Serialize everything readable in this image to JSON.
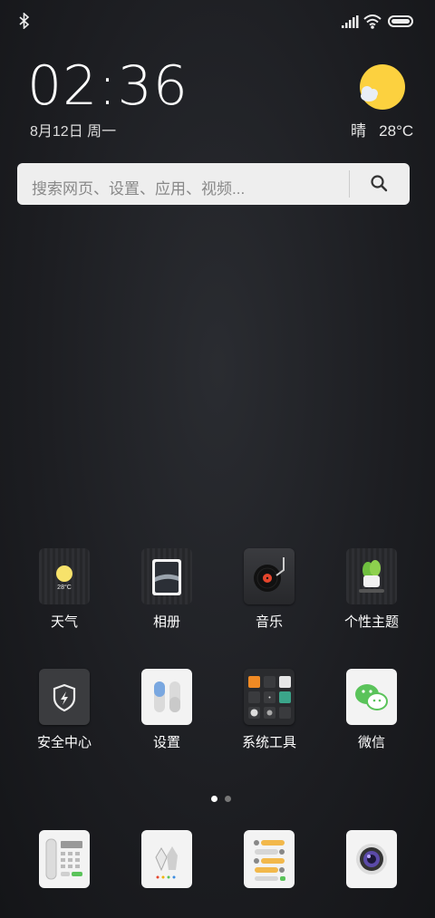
{
  "status_bar": {
    "bluetooth_icon": "bluetooth-icon",
    "signal_icon": "cell-signal-icon",
    "wifi_icon": "wifi-icon",
    "battery_icon": "battery-icon"
  },
  "clock": {
    "time": "02:36",
    "date": "8月12日 周一"
  },
  "weather": {
    "condition": "晴",
    "temperature": "28°C",
    "icon": "partly-sunny-icon"
  },
  "search": {
    "placeholder": "搜索网页、设置、应用、视频..."
  },
  "apps_row1": [
    {
      "label": "天气",
      "tile_text": "28°C",
      "icon": "weather-icon"
    },
    {
      "label": "相册",
      "icon": "gallery-icon"
    },
    {
      "label": "音乐",
      "icon": "music-icon"
    },
    {
      "label": "个性主题",
      "icon": "themes-icon"
    }
  ],
  "apps_row2": [
    {
      "label": "安全中心",
      "icon": "security-icon"
    },
    {
      "label": "设置",
      "icon": "settings-icon"
    },
    {
      "label": "系统工具",
      "icon": "system-tools-folder-icon"
    },
    {
      "label": "微信",
      "icon": "wechat-icon"
    }
  ],
  "dock": [
    {
      "icon": "phone-icon"
    },
    {
      "icon": "contacts-icon"
    },
    {
      "icon": "messages-icon"
    },
    {
      "icon": "camera-icon"
    }
  ],
  "page_indicator": {
    "pages": 2,
    "current": 1
  }
}
